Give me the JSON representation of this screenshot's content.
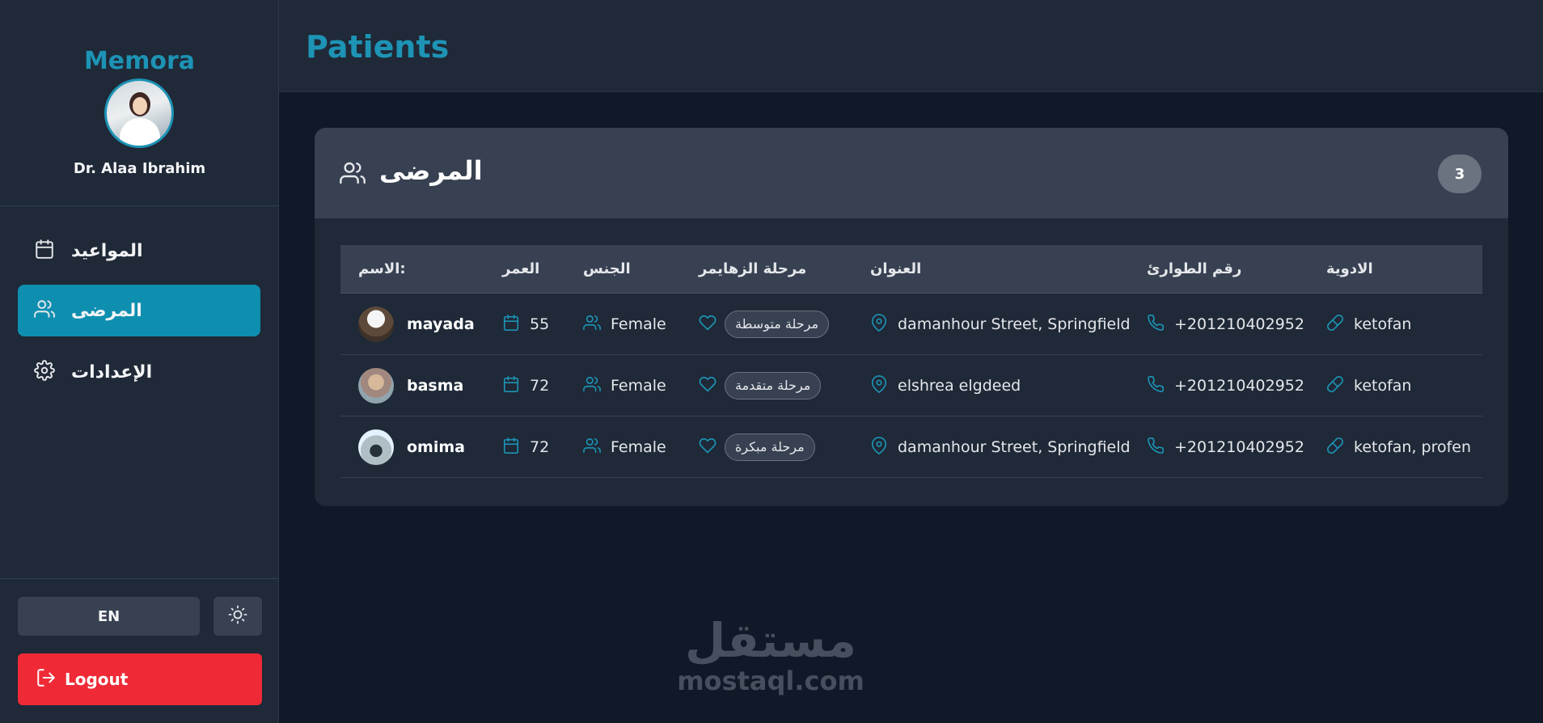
{
  "brand": "Memora",
  "doctor": {
    "name": "Dr. Alaa Ibrahim"
  },
  "nav": [
    {
      "label": "المواعيد",
      "icon": "calendar-icon",
      "active": false
    },
    {
      "label": "المرضى",
      "icon": "users-icon",
      "active": true
    },
    {
      "label": "الإعدادات",
      "icon": "gear-icon",
      "active": false
    }
  ],
  "footer": {
    "lang_label": "EN",
    "theme_icon": "sun-icon",
    "logout_label": "Logout"
  },
  "header": {
    "title": "Patients"
  },
  "card": {
    "title": "المرضى",
    "count": "3"
  },
  "table": {
    "headers": {
      "name": "الاسم:",
      "age": "العمر",
      "gender": "الجنس",
      "stage": "مرحلة الزهايمر",
      "address": "العنوان",
      "phone": "رقم الطوارئ",
      "meds": "الادوية"
    },
    "rows": [
      {
        "name": "mayada",
        "age": "55",
        "gender": "Female",
        "stage": "مرحلة متوسطة",
        "address": "damanhour Street, Springfield",
        "phone": "+201210402952",
        "meds": "ketofan"
      },
      {
        "name": "basma",
        "age": "72",
        "gender": "Female",
        "stage": "مرحلة متقدمة",
        "address": "elshrea elgdeed",
        "phone": "+201210402952",
        "meds": "ketofan"
      },
      {
        "name": "omima",
        "age": "72",
        "gender": "Female",
        "stage": "مرحلة مبكرة",
        "address": "damanhour Street, Springfield",
        "phone": "+201210402952",
        "meds": "ketofan, profen"
      }
    ]
  },
  "watermark": {
    "arabic": "مستقل",
    "latin": "mostaql.com"
  },
  "colors": {
    "accent": "#1d93b5",
    "danger": "#ef2a36",
    "bg": "#111827",
    "panel": "#1f2937"
  }
}
